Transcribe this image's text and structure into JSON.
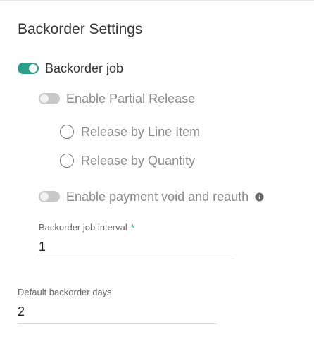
{
  "panel": {
    "title": "Backorder Settings"
  },
  "backorder_job": {
    "label": "Backorder job",
    "enabled": true
  },
  "partial_release": {
    "label": "Enable Partial Release",
    "enabled": false,
    "options": [
      {
        "label": "Release by Line Item",
        "selected": false
      },
      {
        "label": "Release by Quantity",
        "selected": false
      }
    ]
  },
  "payment_void": {
    "label": "Enable payment void and reauth",
    "enabled": false,
    "info_icon": "info-icon"
  },
  "job_interval": {
    "label": "Backorder job interval",
    "required_marker": "*",
    "value": "1"
  },
  "default_days": {
    "label": "Default backorder days",
    "value": "2"
  },
  "colors": {
    "accent": "#2aa08a",
    "toggle_off": "#c7c7c7",
    "text": "#333333",
    "muted_text": "#888888"
  }
}
